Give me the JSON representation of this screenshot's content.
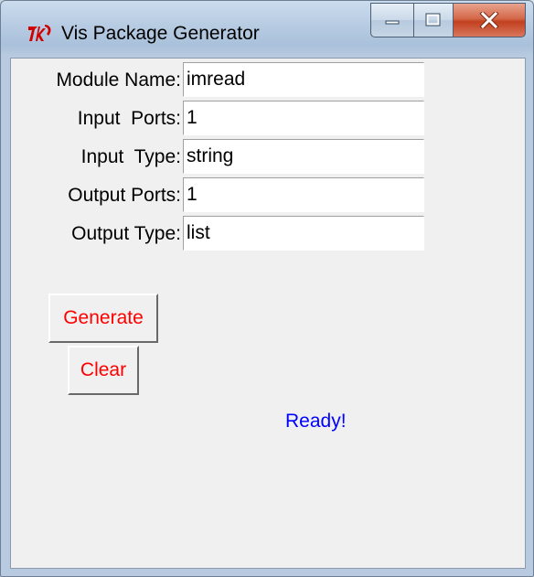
{
  "window": {
    "title": "Vis Package Generator",
    "icon": "tk-feather-icon",
    "controls": {
      "minimize_icon": "minimize-icon",
      "maximize_icon": "maximize-icon",
      "close_icon": "close-icon"
    }
  },
  "form": {
    "fields": [
      {
        "label": "Module Name:",
        "value": "imread"
      },
      {
        "label": "Input  Ports:",
        "value": "1"
      },
      {
        "label": "Input  Type:",
        "value": "string"
      },
      {
        "label": "Output Ports:",
        "value": "1"
      },
      {
        "label": "Output Type:",
        "value": "list"
      }
    ]
  },
  "buttons": {
    "generate_label": "Generate",
    "clear_label": "Clear"
  },
  "status": {
    "text": "Ready!"
  },
  "colors": {
    "button_text": "#ff0000",
    "status_text": "#0000ff",
    "client_bg": "#f0f0f0"
  }
}
